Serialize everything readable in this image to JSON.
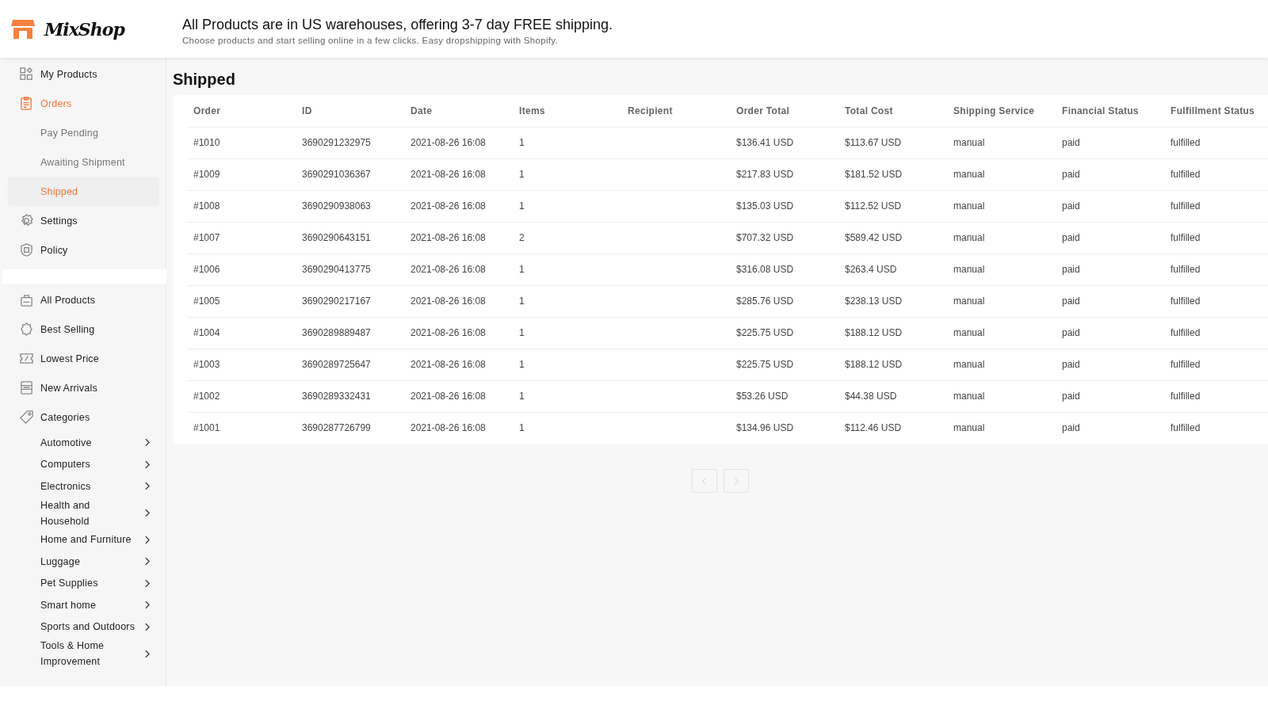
{
  "header": {
    "logo": "MixShop",
    "headline": "All Products are in US warehouses, offering 3-7 day FREE shipping.",
    "subline": "Choose products and start selling online in a few clicks. Easy dropshipping with Shopify."
  },
  "sidebar": {
    "groups": [
      {
        "items": [
          {
            "label": "My Products",
            "selected": false
          },
          {
            "label": "Orders",
            "selected": true,
            "children": [
              {
                "label": "Pay Pending",
                "selected": false
              },
              {
                "label": "Awaiting Shipment",
                "selected": false
              },
              {
                "label": "Shipped",
                "selected": true
              }
            ]
          },
          {
            "label": "Settings",
            "selected": false
          },
          {
            "label": "Policy",
            "selected": false
          }
        ]
      },
      {
        "items": [
          {
            "label": "All Products",
            "selected": false
          },
          {
            "label": "Best Selling",
            "selected": false
          },
          {
            "label": "Lowest Price",
            "selected": false
          },
          {
            "label": "New Arrivals",
            "selected": false
          },
          {
            "label": "Categories",
            "selected": false,
            "children": [
              {
                "label": "Automotive"
              },
              {
                "label": "Computers"
              },
              {
                "label": "Electronics"
              },
              {
                "label": "Health and Household"
              },
              {
                "label": "Home and Furniture"
              },
              {
                "label": "Luggage"
              },
              {
                "label": "Pet Supplies"
              },
              {
                "label": "Smart home"
              },
              {
                "label": "Sports and Outdoors"
              },
              {
                "label": "Tools & Home Improvement"
              }
            ]
          }
        ]
      }
    ]
  },
  "page_title": "Shipped",
  "table": {
    "columns": [
      "Order",
      "ID",
      "Date",
      "Items",
      "Recipient",
      "Order Total",
      "Total Cost",
      "Shipping Service",
      "Financial Status",
      "Fulfillment Status"
    ],
    "rows": [
      [
        "#1010",
        "3690291232975",
        "2021-08-26 16:08",
        "1",
        "",
        "$136.41 USD",
        "$113.67 USD",
        "manual",
        "paid",
        "fulfilled"
      ],
      [
        "#1009",
        "3690291036367",
        "2021-08-26 16:08",
        "1",
        "",
        "$217.83 USD",
        "$181.52 USD",
        "manual",
        "paid",
        "fulfilled"
      ],
      [
        "#1008",
        "3690290938063",
        "2021-08-26 16:08",
        "1",
        "",
        "$135.03 USD",
        "$112.52 USD",
        "manual",
        "paid",
        "fulfilled"
      ],
      [
        "#1007",
        "3690290643151",
        "2021-08-26 16:08",
        "2",
        "",
        "$707.32 USD",
        "$589.42 USD",
        "manual",
        "paid",
        "fulfilled"
      ],
      [
        "#1006",
        "3690290413775",
        "2021-08-26 16:08",
        "1",
        "",
        "$316.08 USD",
        "$263.4 USD",
        "manual",
        "paid",
        "fulfilled"
      ],
      [
        "#1005",
        "3690290217167",
        "2021-08-26 16:08",
        "1",
        "",
        "$285.76 USD",
        "$238.13 USD",
        "manual",
        "paid",
        "fulfilled"
      ],
      [
        "#1004",
        "3690289889487",
        "2021-08-26 16:08",
        "1",
        "",
        "$225.75 USD",
        "$188.12 USD",
        "manual",
        "paid",
        "fulfilled"
      ],
      [
        "#1003",
        "3690289725647",
        "2021-08-26 16:08",
        "1",
        "",
        "$225.75 USD",
        "$188.12 USD",
        "manual",
        "paid",
        "fulfilled"
      ],
      [
        "#1002",
        "3690289332431",
        "2021-08-26 16:08",
        "1",
        "",
        "$53.26 USD",
        "$44.38 USD",
        "manual",
        "paid",
        "fulfilled"
      ],
      [
        "#1001",
        "3690287726799",
        "2021-08-26 16:08",
        "1",
        "",
        "$134.96 USD",
        "$112.46 USD",
        "manual",
        "paid",
        "fulfilled"
      ]
    ]
  },
  "pagination": {
    "previous_disabled": true,
    "next_disabled": true
  }
}
